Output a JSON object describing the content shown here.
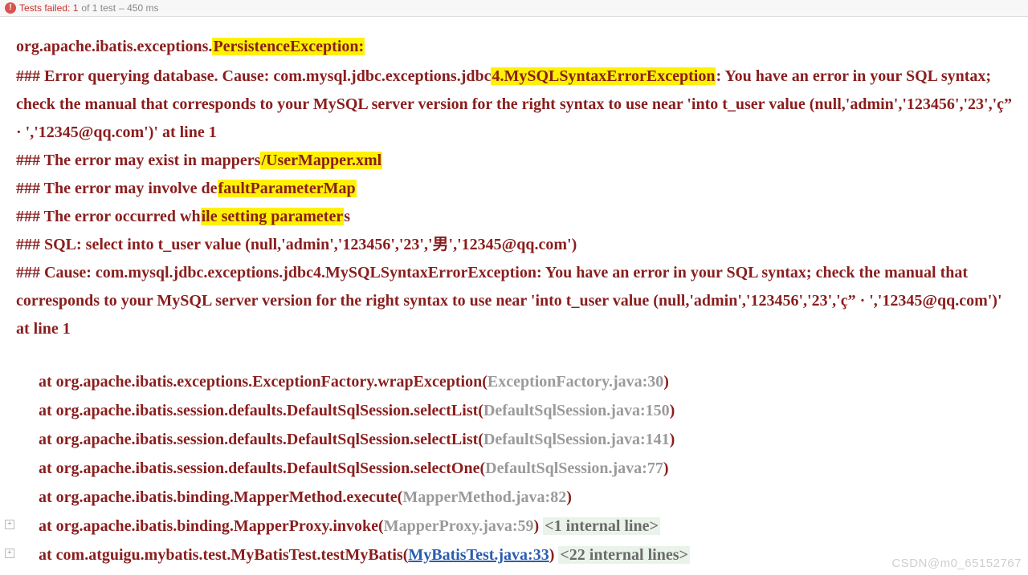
{
  "status": {
    "failed_label": "Tests failed:",
    "failed_count": "1",
    "total_text": "of 1 test",
    "duration": "– 450 ms"
  },
  "err": {
    "p1_a": "org.apache.ibatis.exceptions.",
    "p1_b": "PersistenceException:",
    "p2_a": "### Error querying database.  Cause: com.mysql.jdbc.exceptions.jdbc",
    "p2_b": "4.MySQLSyntaxErrorException",
    "p2_c": ": You have an error in your SQL syntax; check the manual that corresponds to your MySQL server version for the right syntax to use near 'into t_user value (null,'admin','123456','23','ç”   · ','12345@qq.com')' at line 1",
    "p3_a": "### The error may exist in mappers",
    "p3_b": "/UserMapper.xml",
    "p4_a": "### The error may involve de",
    "p4_b": "faultParameterMap",
    "p5_a": "### The error occurred wh",
    "p5_b": "ile setting parameter",
    "p5_c": "s",
    "p6": "### SQL: select into t_user value (null,'admin','123456','23','男','12345@qq.com')",
    "p7": "### Cause: com.mysql.jdbc.exceptions.jdbc4.MySQLSyntaxErrorException: You have an error in your SQL syntax; check the manual that corresponds to your MySQL server version for the right syntax to use near 'into t_user value (null,'admin','123456','23','ç”   · ','12345@qq.com')' at line 1"
  },
  "stack": [
    {
      "method": "org.apache.ibatis.exceptions.ExceptionFactory.wrapException",
      "loc": "ExceptionFactory.java:30",
      "style": "gray",
      "internal": ""
    },
    {
      "method": "org.apache.ibatis.session.defaults.DefaultSqlSession.selectList",
      "loc": "DefaultSqlSession.java:150",
      "style": "gray",
      "internal": ""
    },
    {
      "method": "org.apache.ibatis.session.defaults.DefaultSqlSession.selectList",
      "loc": "DefaultSqlSession.java:141",
      "style": "gray",
      "internal": ""
    },
    {
      "method": "org.apache.ibatis.session.defaults.DefaultSqlSession.selectOne",
      "loc": "DefaultSqlSession.java:77",
      "style": "gray",
      "internal": ""
    },
    {
      "method": "org.apache.ibatis.binding.MapperMethod.execute",
      "loc": "MapperMethod.java:82",
      "style": "gray",
      "internal": ""
    },
    {
      "method": "org.apache.ibatis.binding.MapperProxy.invoke",
      "loc": "MapperProxy.java:59",
      "style": "gray",
      "internal": "<1 internal line>",
      "expand": true
    },
    {
      "method": "com.atguigu.mybatis.test.MyBatisTest.testMyBatis",
      "loc": "MyBatisTest.java:33",
      "style": "blue",
      "internal": "<22 internal lines>",
      "expand": true
    }
  ],
  "at_label": "at ",
  "watermark": "CSDN@m0_65152767"
}
